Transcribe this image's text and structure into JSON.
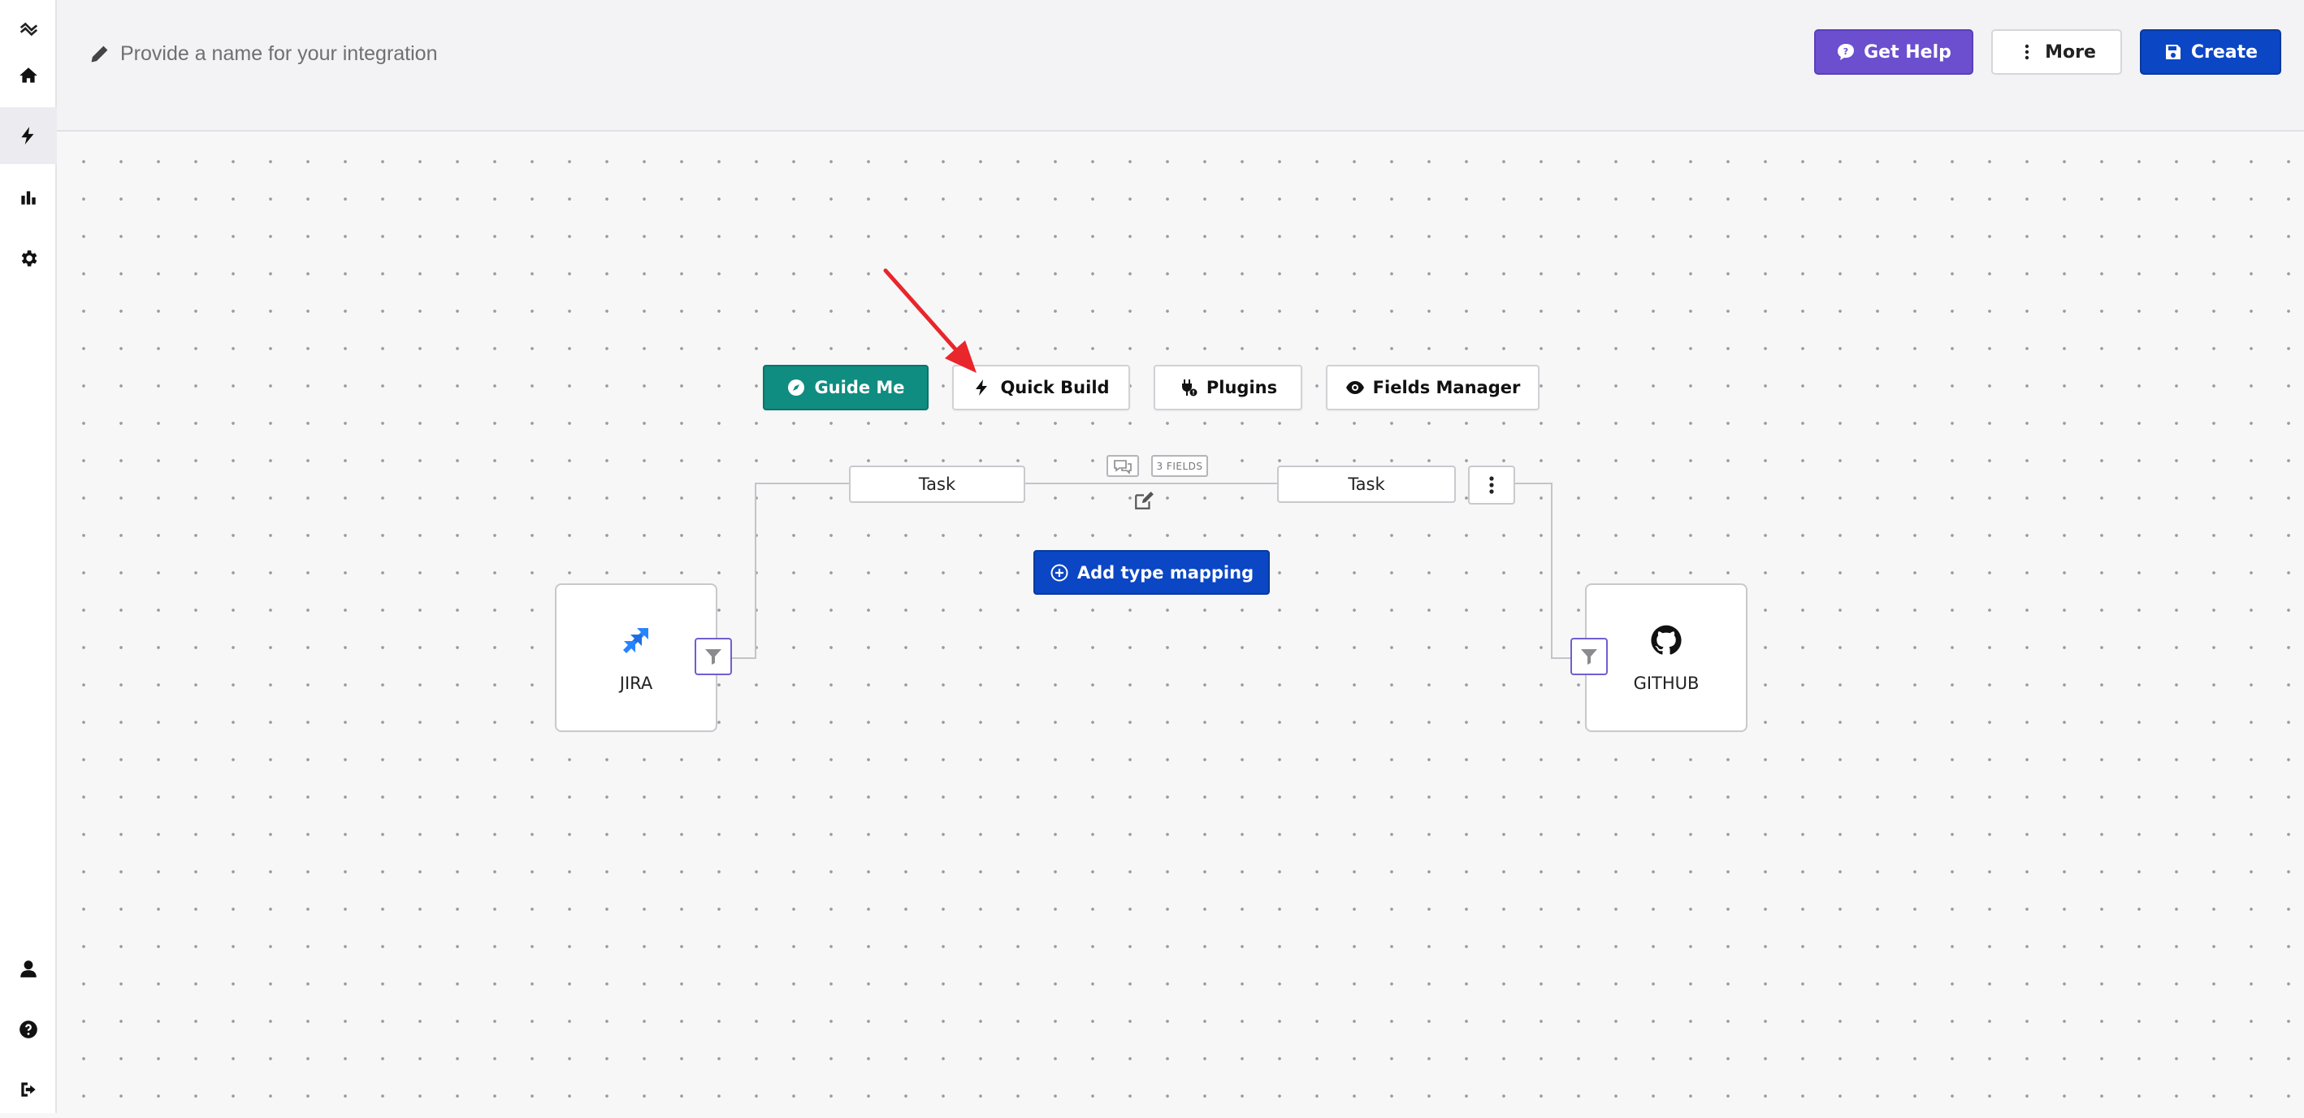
{
  "header": {
    "name_placeholder": "Provide a name for your integration",
    "get_help_label": "Get Help",
    "more_label": "More",
    "create_label": "Create"
  },
  "sidebar": {
    "items": [
      {
        "name": "logo-icon"
      },
      {
        "name": "home-icon"
      },
      {
        "name": "bolt-icon",
        "active": true
      },
      {
        "name": "chart-icon"
      },
      {
        "name": "gear-icon"
      },
      {
        "name": "user-icon"
      },
      {
        "name": "question-icon"
      },
      {
        "name": "logout-icon"
      }
    ]
  },
  "toolbar": {
    "guide_me": "Guide Me",
    "quick_build": "Quick Build",
    "plugins": "Plugins",
    "fields_manager": "Fields Manager"
  },
  "mapping": {
    "left_type": "Task",
    "right_type": "Task",
    "fields_badge": "3 FIELDS",
    "add_label": "Add type mapping"
  },
  "nodes": {
    "left": "JIRA",
    "right": "GITHUB"
  },
  "colors": {
    "help_purple": "#6b4fcf",
    "primary_blue": "#0b46c4",
    "guide_teal": "#0f8d80",
    "annotation_red": "#e8262b",
    "jira_blue": "#2684ff"
  }
}
